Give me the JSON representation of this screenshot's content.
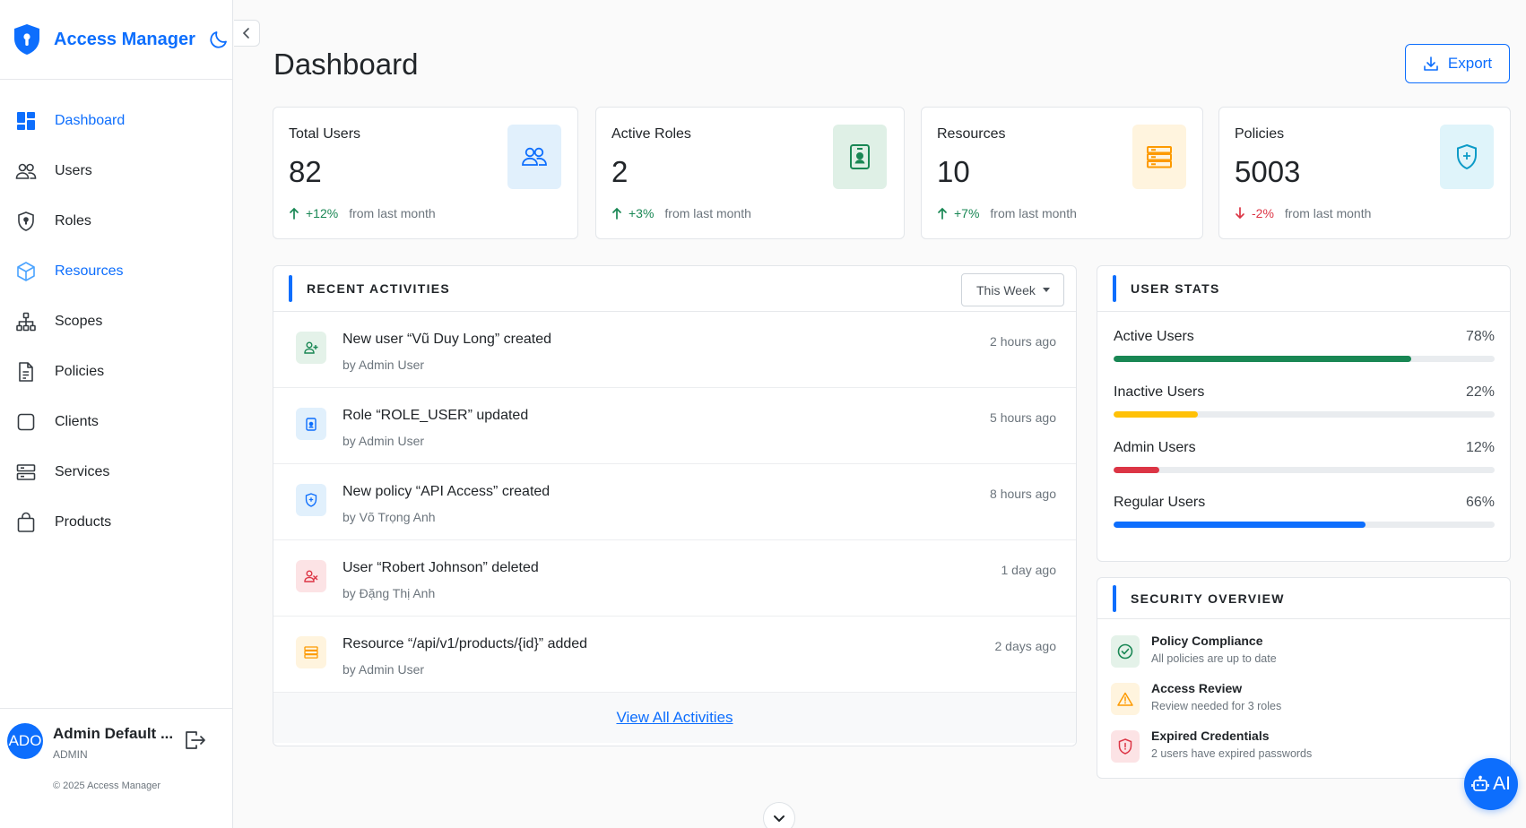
{
  "app": {
    "name": "Access Manager"
  },
  "nav": {
    "items": [
      {
        "label": "Dashboard",
        "icon": "dashboard-icon"
      },
      {
        "label": "Users",
        "icon": "users-icon"
      },
      {
        "label": "Roles",
        "icon": "shield-icon"
      },
      {
        "label": "Resources",
        "icon": "box-icon"
      },
      {
        "label": "Scopes",
        "icon": "sitemap-icon"
      },
      {
        "label": "Policies",
        "icon": "file-icon"
      },
      {
        "label": "Clients",
        "icon": "square-icon"
      },
      {
        "label": "Services",
        "icon": "server-icon"
      },
      {
        "label": "Products",
        "icon": "bag-icon"
      }
    ]
  },
  "user": {
    "initials": "ADO",
    "name": "Admin Default ...",
    "role": "ADMIN"
  },
  "footer": {
    "copyright": "© 2025 Access Manager"
  },
  "page": {
    "title": "Dashboard",
    "export_label": "Export"
  },
  "stats": [
    {
      "title": "Total Users",
      "value": "82",
      "trend": "+12%",
      "direction": "up",
      "trend_text": "from last month",
      "icon": "users-icon",
      "color": "#0d6efd"
    },
    {
      "title": "Active Roles",
      "value": "2",
      "trend": "+3%",
      "direction": "up",
      "trend_text": "from last month",
      "icon": "id-badge-icon",
      "color": "#198754"
    },
    {
      "title": "Resources",
      "value": "10",
      "trend": "+7%",
      "direction": "up",
      "trend_text": "from last month",
      "icon": "server-icon",
      "color": "#fd9a00"
    },
    {
      "title": "Policies",
      "value": "5003",
      "trend": "-2%",
      "direction": "down",
      "trend_text": "from last month",
      "icon": "shield-icon",
      "color": "#0dcaf0"
    }
  ],
  "activities": {
    "title": "RECENT ACTIVITIES",
    "filter": "This Week",
    "items": [
      {
        "title": "New user “Vũ Duy Long” created",
        "by": "by Admin User",
        "time": "2 hours ago",
        "icon": "user-plus-icon"
      },
      {
        "title": "Role “ROLE_USER” updated",
        "by": "by Admin User",
        "time": "5 hours ago",
        "icon": "id-badge-icon"
      },
      {
        "title": "New policy “API Access” created",
        "by": "by Võ Trọng Anh",
        "time": "8 hours ago",
        "icon": "shield-icon"
      },
      {
        "title": "User “Robert Johnson” deleted",
        "by": "by Đặng Thị Anh",
        "time": "1 day ago",
        "icon": "user-minus-icon"
      },
      {
        "title": "Resource “/api/v1/products/{id}” added",
        "by": "by Admin User",
        "time": "2 days ago",
        "icon": "server-icon"
      }
    ],
    "view_all": "View All Activities"
  },
  "user_stats": {
    "title": "USER STATS",
    "items": [
      {
        "label": "Active Users",
        "pct_label": "78%",
        "value": 0.78,
        "color": "#198754"
      },
      {
        "label": "Inactive Users",
        "pct_label": "22%",
        "value": 0.22,
        "color": "#ffc107"
      },
      {
        "label": "Admin Users",
        "pct_label": "12%",
        "value": 0.12,
        "color": "#dc3545"
      },
      {
        "label": "Regular Users",
        "pct_label": "66%",
        "value": 0.66,
        "color": "#0d6efd"
      }
    ]
  },
  "security": {
    "title": "SECURITY OVERVIEW",
    "items": [
      {
        "title": "Policy Compliance",
        "desc": "All policies are up to date",
        "icon": "check-circle-icon",
        "color": "#198754"
      },
      {
        "title": "Access Review",
        "desc": "Review needed for 3 roles",
        "icon": "warning-icon",
        "color": "#fd9a00"
      },
      {
        "title": "Expired Credentials",
        "desc": "2 users have expired passwords",
        "icon": "shield-alert-icon",
        "color": "#dc3545"
      }
    ]
  },
  "ai": {
    "label": "AI"
  }
}
